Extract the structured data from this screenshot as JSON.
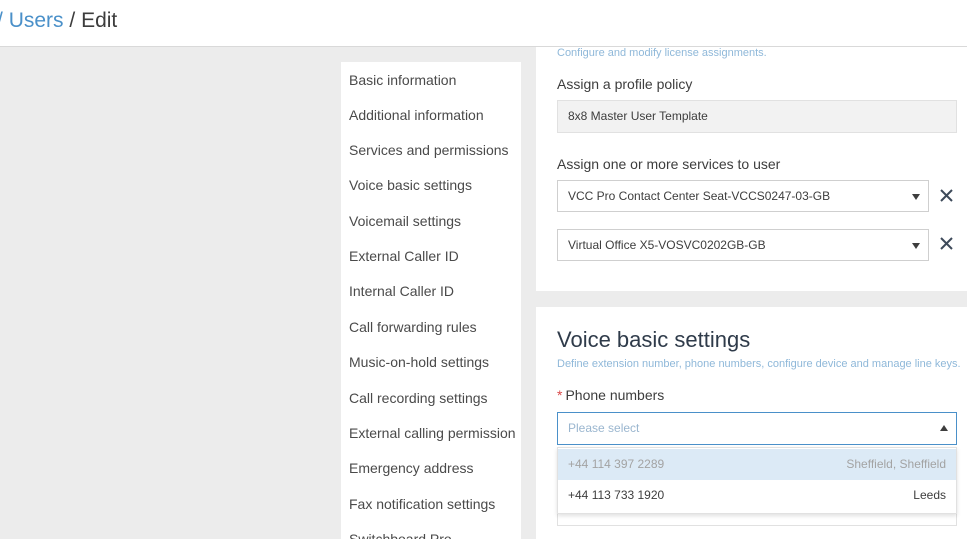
{
  "breadcrumb": {
    "separator_1": "/",
    "users": "Users",
    "separator_2": "/",
    "current": "Edit"
  },
  "sidebar": {
    "items": [
      {
        "label": "Basic information"
      },
      {
        "label": "Additional information"
      },
      {
        "label": "Services and permissions"
      },
      {
        "label": "Voice basic settings"
      },
      {
        "label": "Voicemail settings"
      },
      {
        "label": "External Caller ID"
      },
      {
        "label": "Internal Caller ID"
      },
      {
        "label": "Call forwarding rules"
      },
      {
        "label": "Music-on-hold settings"
      },
      {
        "label": "Call recording settings"
      },
      {
        "label": "External calling permission"
      },
      {
        "label": "Emergency address"
      },
      {
        "label": "Fax notification settings"
      },
      {
        "label": "Switchboard Pro"
      }
    ]
  },
  "services": {
    "description": "Configure and modify license assignments.",
    "profile_policy_label": "Assign a profile policy",
    "profile_policy_value": "8x8 Master User Template",
    "services_label": "Assign one or more services to user",
    "assigned": [
      {
        "value": "VCC Pro Contact Center Seat-VCCS0247-03-GB",
        "remove_icon": "close-icon"
      },
      {
        "value": "Virtual Office X5-VOSVC0202GB-GB",
        "remove_icon": "close-icon"
      }
    ]
  },
  "voice": {
    "title": "Voice basic settings",
    "description": "Define extension number, phone numbers, configure device and manage line keys.",
    "phone_label": "Phone numbers",
    "required_mark": "*",
    "phone_placeholder": "Please select",
    "options": [
      {
        "number": "+44 114 397 2289",
        "city": "Sheffield, Sheffield"
      },
      {
        "number": "+44 113 733 1920",
        "city": "Leeds"
      }
    ]
  },
  "colors": {
    "link": "#4a90c9",
    "highlight": "#dceaf6",
    "required": "#d94848"
  }
}
